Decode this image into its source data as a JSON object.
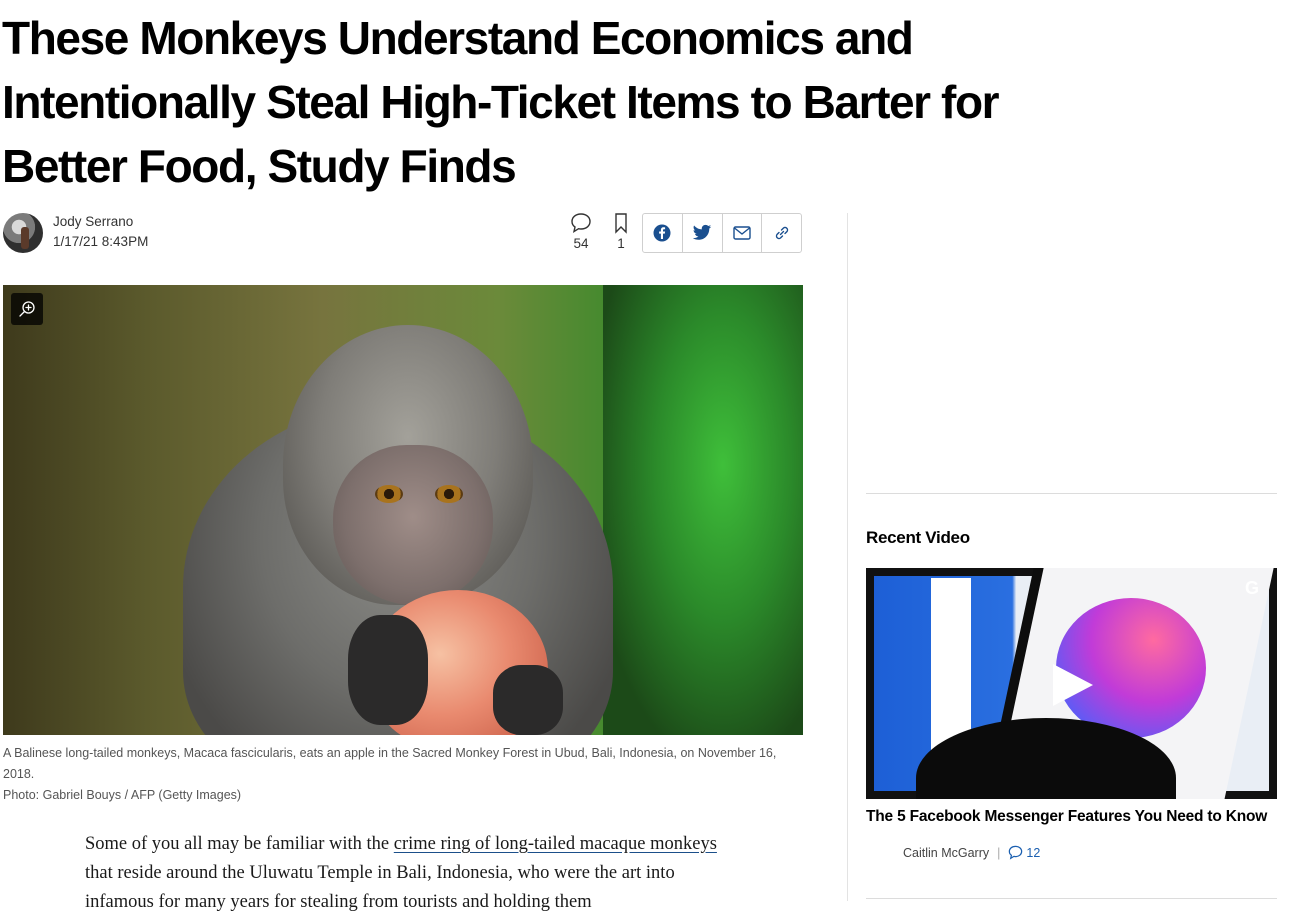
{
  "article": {
    "headline": "These Monkeys Understand Economics and Intentionally Steal High-Ticket Items to Barter for Better Food, Study Finds",
    "author": "Jody Serrano",
    "date": "1/17/21 8:43PM",
    "comment_count": "54",
    "bookmark_count": "1",
    "share": {
      "facebook_icon": "facebook-icon",
      "twitter_icon": "twitter-icon",
      "email_icon": "email-icon",
      "link_icon": "link-icon"
    },
    "image_caption": "A Balinese long-tailed monkeys, Macaca fascicularis, eats an apple in the Sacred Monkey Forest in Ubud, Bali, Indonesia, on November 16, 2018.",
    "image_credit": "Photo: Gabriel Bouys / AFP (Getty Images)",
    "body": {
      "intro_before_link": "Some of you all may be familiar with the ",
      "link_text": "crime ring of long-tailed macaque monkeys",
      "intro_after_link": " that reside around the Uluwatu Temple in Bali, Indonesia, who were",
      "next_line_partial": "the art into infamous for many years for stealing from tourists and holding them"
    }
  },
  "sidebar": {
    "recent_video_heading": "Recent Video",
    "video_title": "The 5 Facebook Messenger Features You Need to Know",
    "video_author": "Caitlin McGarry",
    "video_comment_count": "12",
    "video_badge": "G"
  },
  "colors": {
    "link_underline": "#1b4f8a",
    "comment_accent": "#1b5fb0"
  }
}
